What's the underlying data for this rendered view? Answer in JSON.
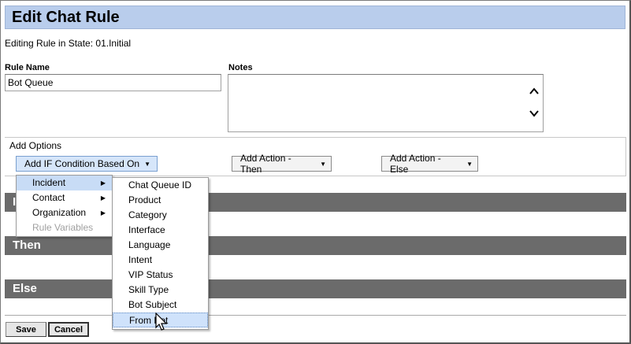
{
  "page": {
    "title": "Edit Chat Rule",
    "state_text": "Editing Rule in State: 01.Initial"
  },
  "form": {
    "rule_name_label": "Rule Name",
    "rule_name_value": "Bot Queue",
    "notes_label": "Notes",
    "notes_value": ""
  },
  "add_options": {
    "legend": "Add Options",
    "if_button": "Add IF Condition Based On",
    "then_button": "Add Action - Then",
    "else_button": "Add Action - Else"
  },
  "sections": {
    "if_label": "If",
    "then_label": "Then",
    "else_label": "Else"
  },
  "condition_menu": {
    "items": [
      {
        "label": "Incident",
        "has_submenu": true,
        "highlighted": true,
        "disabled": false
      },
      {
        "label": "Contact",
        "has_submenu": true,
        "highlighted": false,
        "disabled": false
      },
      {
        "label": "Organization",
        "has_submenu": true,
        "highlighted": false,
        "disabled": false
      },
      {
        "label": "Rule Variables",
        "has_submenu": false,
        "highlighted": false,
        "disabled": true
      }
    ]
  },
  "incident_submenu": {
    "items": [
      {
        "label": "Chat Queue ID"
      },
      {
        "label": "Product"
      },
      {
        "label": "Category"
      },
      {
        "label": "Interface"
      },
      {
        "label": "Language"
      },
      {
        "label": "Intent"
      },
      {
        "label": "VIP Status"
      },
      {
        "label": "Skill Type"
      },
      {
        "label": "Bot Subject"
      },
      {
        "label": "From Bot",
        "hovered": true
      }
    ]
  },
  "buttons": {
    "save": "Save",
    "cancel": "Cancel"
  },
  "colors": {
    "title_bar": "#b9cdec",
    "section_bar": "#6b6b6b",
    "menu_highlight": "#c8dcf6"
  },
  "icons": {
    "dropdown": "caret-down-icon",
    "submenu": "caret-right-icon",
    "scroll_up": "chevron-up-icon",
    "scroll_down": "chevron-down-icon",
    "pointer": "mouse-pointer-icon"
  }
}
